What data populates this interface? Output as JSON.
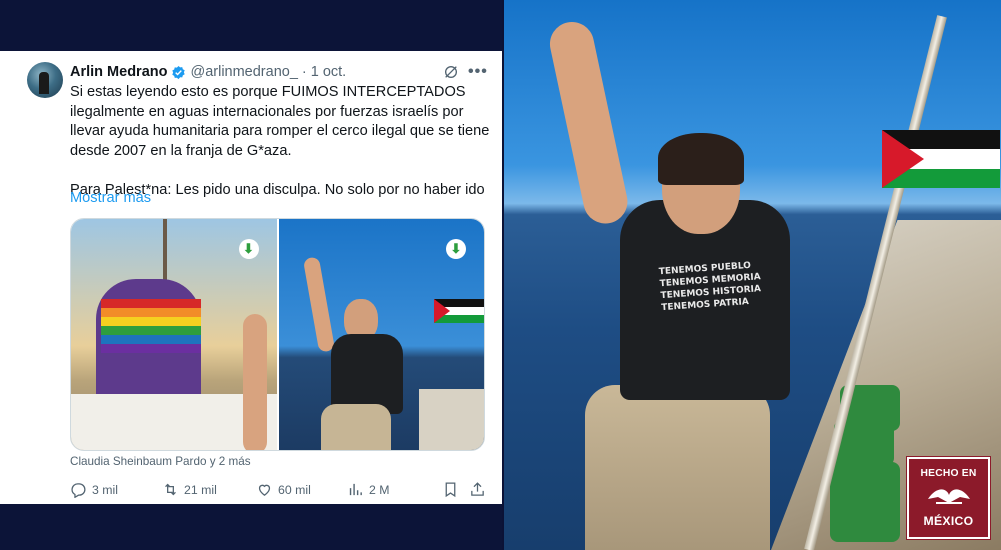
{
  "tweet": {
    "display_name": "Arlin Medrano",
    "handle": "@arlinmedrano_",
    "separator": "·",
    "date": "1 oct.",
    "text_paragraph_1": "Si estas leyendo esto es porque FUIMOS INTERCEPTADOS ilegalmente en aguas internacionales por fuerzas israelís por llevar ayuda humanitaria para romper el cerco ilegal que se tiene desde 2007 en la franja de G*aza.",
    "text_paragraph_2": "Para Palest*na: Les pido una disculpa. No solo por no haber ido",
    "show_more": "Mostrar más",
    "tagged": "Claudia Sheinbaum Pardo y 2 más",
    "actions": {
      "replies": "3 mil",
      "reposts": "21 mil",
      "likes": "60 mil",
      "views": "2 M"
    },
    "icons": [
      "verified-badge-icon",
      "grok-icon",
      "more-icon",
      "download-icon",
      "reply-icon",
      "repost-icon",
      "like-icon",
      "views-icon",
      "bookmark-icon",
      "share-icon"
    ]
  },
  "photo": {
    "shirt_text": "TENEMOS PUEBLO TENEMOS MEMORIA TENEMOS HISTORIA TENEMOS PATRIA"
  },
  "badge": {
    "top": "HECHO EN",
    "bottom": "MÉXICO"
  },
  "colors": {
    "link": "#1d9bf0",
    "verified": "#1d9bf0",
    "badge_bg": "#8c1a2a",
    "frame_bg": "#0c1438"
  }
}
